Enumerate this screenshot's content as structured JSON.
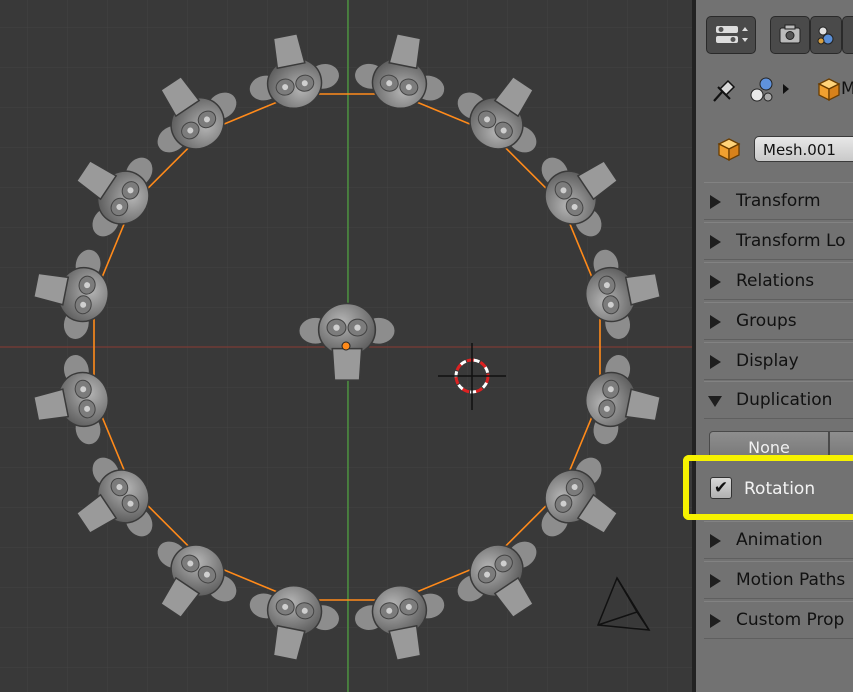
{
  "object_name": "Mesh.001",
  "breadcrumb_tail": "M",
  "sections": [
    {
      "label": "Transform",
      "expanded": false
    },
    {
      "label": "Transform Lo",
      "expanded": false
    },
    {
      "label": "Relations",
      "expanded": false
    },
    {
      "label": "Groups",
      "expanded": false
    },
    {
      "label": "Display",
      "expanded": false
    },
    {
      "label": "Duplication",
      "expanded": true
    },
    {
      "label": "Animation",
      "expanded": false
    },
    {
      "label": "Motion Paths",
      "expanded": false
    },
    {
      "label": "Custom Prop",
      "expanded": false
    }
  ],
  "duplication": {
    "mode_label": "None",
    "rotation_label": "Rotation",
    "rotation_checked": true
  },
  "colors": {
    "highlight": "#f6f200",
    "selection": "#ff8a1a",
    "axis_y": "#4ea53e",
    "axis_x": "#b0473a"
  },
  "icons": {
    "pin": "pin-icon",
    "object_data": "object-data-icon",
    "object": "object-cube-icon",
    "mesh": "mesh-cube-icon",
    "view_nav": "view-navigation-icon"
  }
}
